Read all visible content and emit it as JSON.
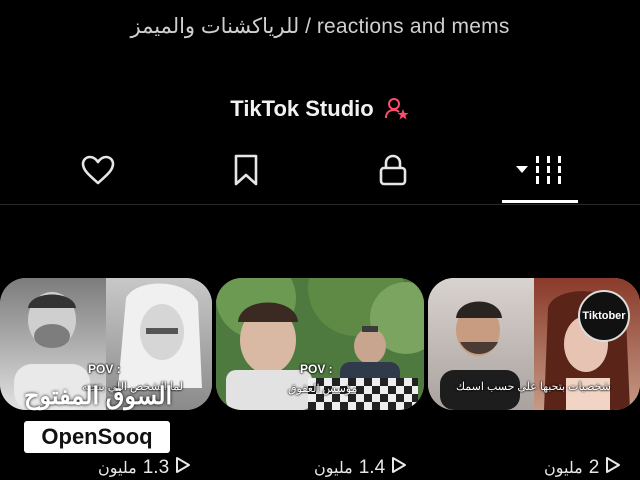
{
  "profile": {
    "bio": "للرياكشنات والميمز / reactions and mems",
    "studio_label": "TikTok Studio"
  },
  "tabs": [
    {
      "name": "liked",
      "icon": "heart-icon"
    },
    {
      "name": "saved",
      "icon": "bookmark-icon"
    },
    {
      "name": "private",
      "icon": "lock-icon"
    },
    {
      "name": "videos",
      "icon": "grid-icon",
      "active": true
    }
  ],
  "videos": [
    {
      "overlay": "POV :",
      "caption": "لما الشخص اللي بتحبه",
      "views": "1.3",
      "views_unit": "مليون"
    },
    {
      "overlay": "POV :",
      "caption": "مؤسس العقوق",
      "views": "1.4",
      "views_unit": "مليون"
    },
    {
      "overlay": "",
      "caption": "شخصيات بتحبها على حسب اسمك",
      "badge": "Tiktober",
      "views": "2",
      "views_unit": "مليون"
    }
  ],
  "watermark": {
    "arabic": "السوق المفتوح",
    "brand": "OpenSooq"
  },
  "colors": {
    "background": "#000000",
    "studio_icon_accent": "#ff4d6d"
  }
}
